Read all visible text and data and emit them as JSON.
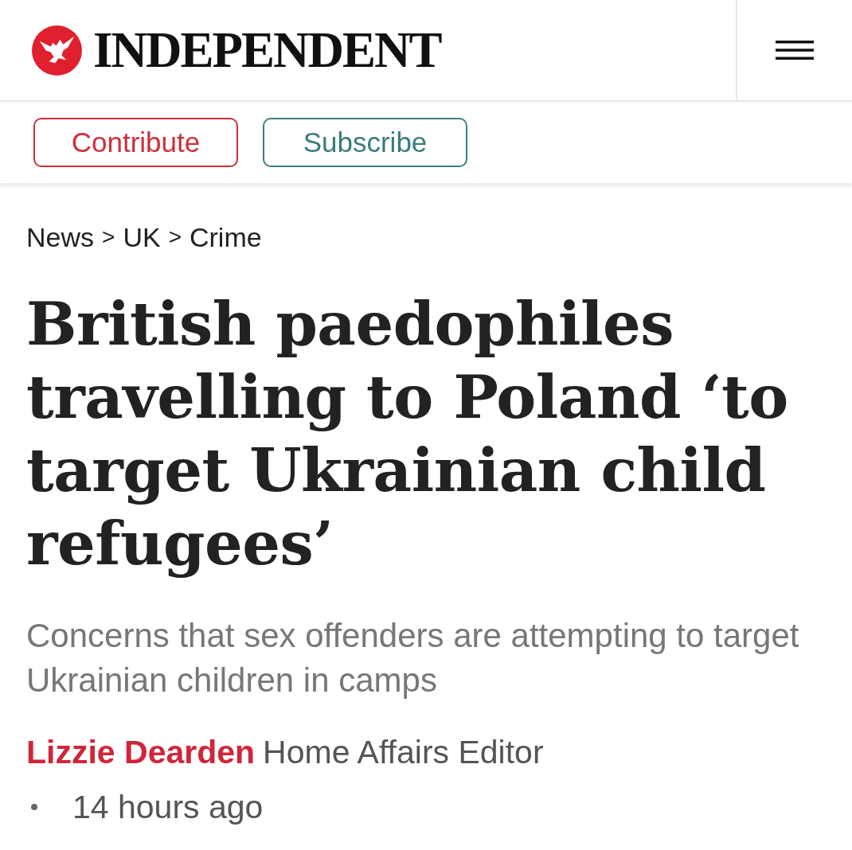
{
  "header": {
    "brand": "INDEPENDENT"
  },
  "actions": [
    {
      "kind": "contribute",
      "label": "Contribute"
    },
    {
      "kind": "subscribe",
      "label": "Subscribe"
    }
  ],
  "breadcrumbs": [
    {
      "kind": "link",
      "text": "News"
    },
    {
      "kind": "separator",
      "text": ">"
    },
    {
      "kind": "link",
      "text": "UK"
    },
    {
      "kind": "separator",
      "text": ">"
    },
    {
      "kind": "link",
      "text": "Crime"
    }
  ],
  "article": {
    "headline": "British paedophiles travelling to Poland ‘to target Ukrainian child refugees’",
    "standfirst": "Concerns that sex offenders are attempting to target Ukrainian children in camps",
    "author": "Lizzie Dearden",
    "author_role": "Home Affairs Editor",
    "published": "14 hours ago"
  }
}
